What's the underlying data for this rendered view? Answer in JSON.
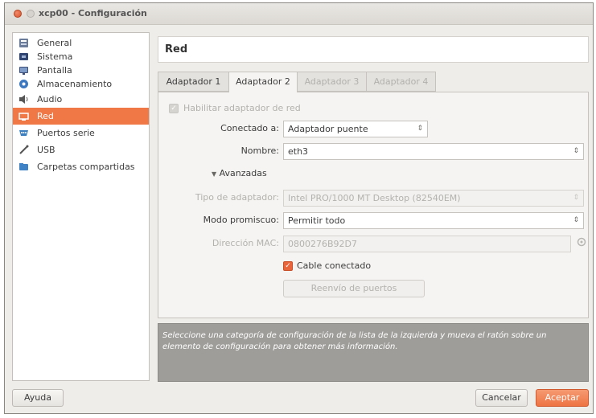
{
  "window": {
    "title": "xcp00 - Configuración"
  },
  "sidebar": {
    "items": [
      {
        "label": "General",
        "icon": "general-icon",
        "color": "#5b6b8a"
      },
      {
        "label": "Sistema",
        "icon": "system-icon",
        "color": "#3a4f7a"
      },
      {
        "label": "Pantalla",
        "icon": "display-icon",
        "color": "#4a5a7a"
      },
      {
        "label": "Almacenamiento",
        "icon": "storage-icon",
        "color": "#4a7ab8"
      },
      {
        "label": "Audio",
        "icon": "audio-icon",
        "color": "#555555"
      },
      {
        "label": "Red",
        "icon": "network-icon",
        "color": "#ffffff"
      },
      {
        "label": "Puertos serie",
        "icon": "serial-port-icon",
        "color": "#4a8ab8"
      },
      {
        "label": "USB",
        "icon": "usb-icon",
        "color": "#555555"
      },
      {
        "label": "Carpetas compartidas",
        "icon": "shared-folder-icon",
        "color": "#4a8ac8"
      }
    ],
    "selected": "Red"
  },
  "main": {
    "header": "Red",
    "tabs": [
      {
        "label": "Adaptador 1",
        "state": "normal"
      },
      {
        "label": "Adaptador 2",
        "state": "active"
      },
      {
        "label": "Adaptador 3",
        "state": "disabled"
      },
      {
        "label": "Adaptador 4",
        "state": "disabled"
      }
    ]
  },
  "form": {
    "enable_adapter_label": "Habilitar adaptador de red",
    "attached_label": "Conectado a:",
    "attached_value": "Adaptador puente",
    "name_label": "Nombre:",
    "name_value": "eth3",
    "advanced_label": "Avanzadas",
    "adapter_type_label": "Tipo de adaptador:",
    "adapter_type_value": "Intel PRO/1000 MT Desktop (82540EM)",
    "promisc_label": "Modo promiscuo:",
    "promisc_value": "Permitir todo",
    "mac_label": "Dirección MAC:",
    "mac_value": "0800276B92D7",
    "cable_label": "Cable conectado",
    "port_forwarding_label": "Reenvío de puertos"
  },
  "info": {
    "text": "Seleccione una categoría de configuración de la lista de la izquierda y mueva el ratón sobre un elemento de configuración para obtener más información."
  },
  "buttons": {
    "help": "Ayuda",
    "cancel": "Cancelar",
    "accept": "Aceptar"
  },
  "colors": {
    "accent": "#f07746",
    "info_bg": "#9f9d9a"
  }
}
